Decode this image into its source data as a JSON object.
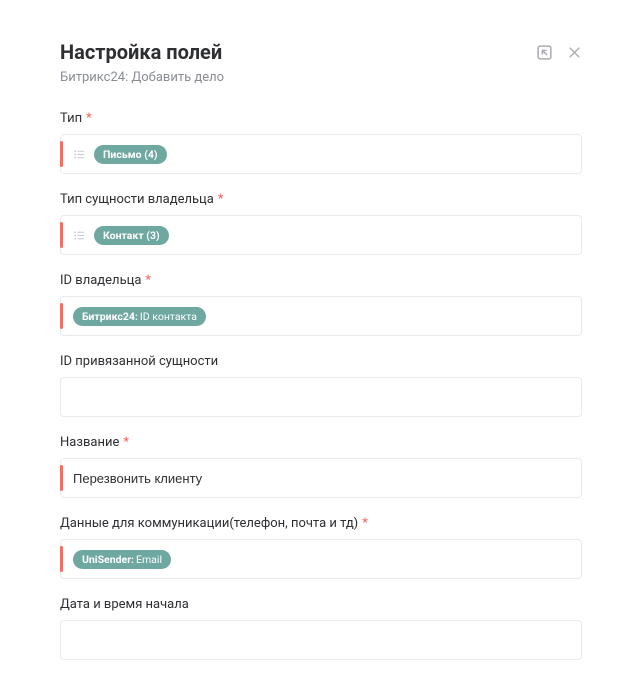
{
  "header": {
    "title": "Настройка полей",
    "subtitle": "Битрикс24: Добавить дело"
  },
  "fields": {
    "type": {
      "label": "Тип",
      "required": true,
      "pill": "Письмо (4)"
    },
    "owner_entity_type": {
      "label": "Тип сущности владельца",
      "required": true,
      "pill": "Контакт (3)"
    },
    "owner_id": {
      "label": "ID владельца",
      "required": true,
      "pill_strong": "Битрикс24:",
      "pill_rest": " ID контакта"
    },
    "bound_entity_id": {
      "label": "ID привязанной сущности",
      "required": false
    },
    "name": {
      "label": "Название",
      "required": true,
      "value": "Перезвонить клиенту"
    },
    "comm_data": {
      "label": "Данные для коммуникации(телефон, почта и тд)",
      "required": true,
      "pill_strong": "UniSender:",
      "pill_rest": " Email"
    },
    "start_datetime": {
      "label": "Дата и время начала",
      "required": false
    }
  }
}
